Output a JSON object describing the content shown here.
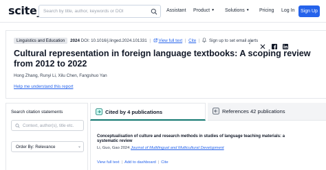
{
  "header": {
    "logo": "scite_",
    "search_placeholder": "Search by title, author, keywords or DOI",
    "nav": {
      "assistant": "Assistant",
      "product": "Product",
      "solutions": "Solutions",
      "pricing": "Pricing",
      "login": "Log In",
      "signup": "Sign Up"
    },
    "colors": {
      "accent": "#2563eb",
      "cited_tab_underline": "#0f766e"
    }
  },
  "paper": {
    "journal": "Linguistics and Education",
    "year": "2024",
    "doi": "DOI: 10.1016/j.linged.2024.101331",
    "view_full_text": "View full text",
    "cite": "Cite",
    "alert": "Sign up to set email alerts",
    "title": "Cultural representation in foreign language textbooks: A scoping review from 2012 to 2022",
    "authors": "Hong Zhang, Runyi Li, Xilu Chen, Fangshuo Yan",
    "help_link": "Help me understand this report"
  },
  "sidebar": {
    "title": "Search citation statements",
    "search_placeholder": "Context, author(s), title etc.",
    "order_by": "Order By: Relevance"
  },
  "tabs": {
    "cited_by": "Cited by 4 publications",
    "references": "References 42 publications"
  },
  "results": [
    {
      "title": "Conceptualisation of culture and research methods in studies of language teaching materials: a systematic review",
      "meta_prefix": "Li, Guo, Gao 2024",
      "journal": "Journal of Multilingual and Multicultural Development",
      "actions": {
        "view": "View full text",
        "dashboard": "Add to dashboard",
        "cite": "Cite"
      }
    }
  ]
}
